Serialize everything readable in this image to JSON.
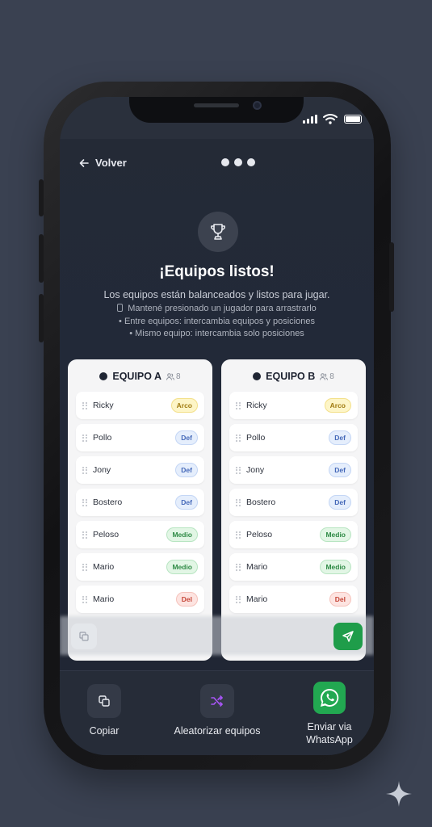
{
  "nav": {
    "back_label": "Volver"
  },
  "header": {
    "title": "¡Equipos listos!",
    "subtitle": "Los equipos están balanceados y listos para jugar.",
    "tips": [
      "Mantené presionado un jugador para arrastrarlo",
      "• Entre equipos: intercambia equipos y posiciones",
      "• Mismo equipo: intercambia solo posiciones"
    ]
  },
  "teams": [
    {
      "name": "EQUIPO A",
      "count": "8",
      "players": [
        {
          "name": "Ricky",
          "position": "Arco"
        },
        {
          "name": "Pollo",
          "position": "Def"
        },
        {
          "name": "Jony",
          "position": "Def"
        },
        {
          "name": "Bostero",
          "position": "Def"
        },
        {
          "name": "Peloso",
          "position": "Medio"
        },
        {
          "name": "Mario",
          "position": "Medio"
        },
        {
          "name": "Mario",
          "position": "Del"
        }
      ]
    },
    {
      "name": "EQUIPO B",
      "count": "8",
      "players": [
        {
          "name": "Ricky",
          "position": "Arco"
        },
        {
          "name": "Pollo",
          "position": "Def"
        },
        {
          "name": "Jony",
          "position": "Def"
        },
        {
          "name": "Bostero",
          "position": "Def"
        },
        {
          "name": "Peloso",
          "position": "Medio"
        },
        {
          "name": "Mario",
          "position": "Medio"
        },
        {
          "name": "Mario",
          "position": "Del"
        }
      ]
    }
  ],
  "actions": {
    "copy_label": "Copiar",
    "shuffle_label": "Aleatorizar equipos",
    "whatsapp_label_line1": "Enviar via",
    "whatsapp_label_line2": "WhatsApp"
  },
  "icons": {
    "back": "arrow-left-icon",
    "trophy": "trophy-icon",
    "users": "users-icon",
    "copy": "copy-icon",
    "shuffle": "shuffle-icon",
    "whatsapp": "whatsapp-icon",
    "send": "send-icon",
    "drag": "drag-handle-icon"
  },
  "colors": {
    "accent_green": "#22a851",
    "arco": "#fdf5c7",
    "def": "#e5eefc",
    "medio": "#e2f6e5",
    "del": "#fde4e1"
  }
}
